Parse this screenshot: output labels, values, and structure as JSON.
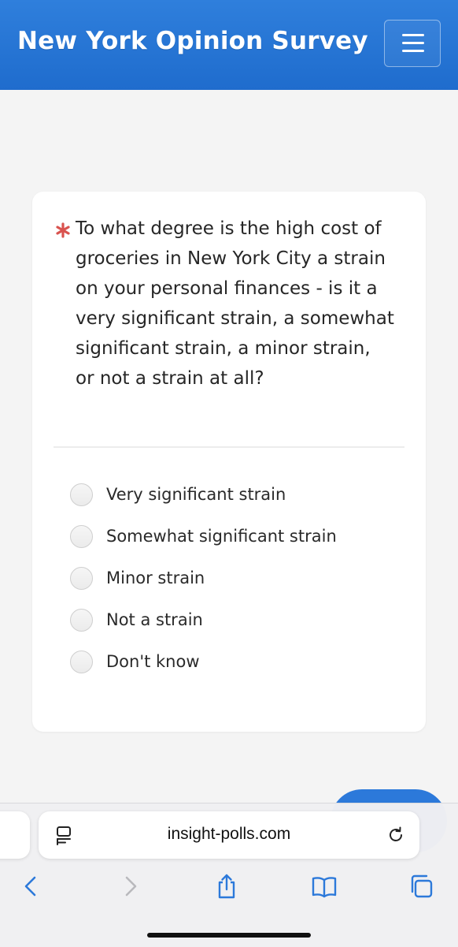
{
  "header": {
    "title": "New York Opinion Survey",
    "menu_icon": "hamburger-menu-icon"
  },
  "question": {
    "required_marker_icon": "asterisk-icon",
    "required_color": "#d9534f",
    "text": "To what degree is the high cost of groceries in New York City a strain on your personal finances - is it a very significant strain, a somewhat significant strain, a minor strain, or not a strain at all?"
  },
  "options": [
    {
      "label": "Very significant strain",
      "selected": false
    },
    {
      "label": "Somewhat significant strain",
      "selected": false
    },
    {
      "label": "Minor strain",
      "selected": false
    },
    {
      "label": "Not a strain",
      "selected": false
    },
    {
      "label": "Don't know",
      "selected": false
    }
  ],
  "browser": {
    "url": "insight-polls.com",
    "toolbar_icons": [
      "back-icon",
      "forward-icon",
      "share-icon",
      "bookmarks-icon",
      "tabs-icon"
    ]
  },
  "colors": {
    "header_bg": "#2576d6",
    "accent": "#2c79da",
    "page_bg": "#f4f4f4"
  }
}
